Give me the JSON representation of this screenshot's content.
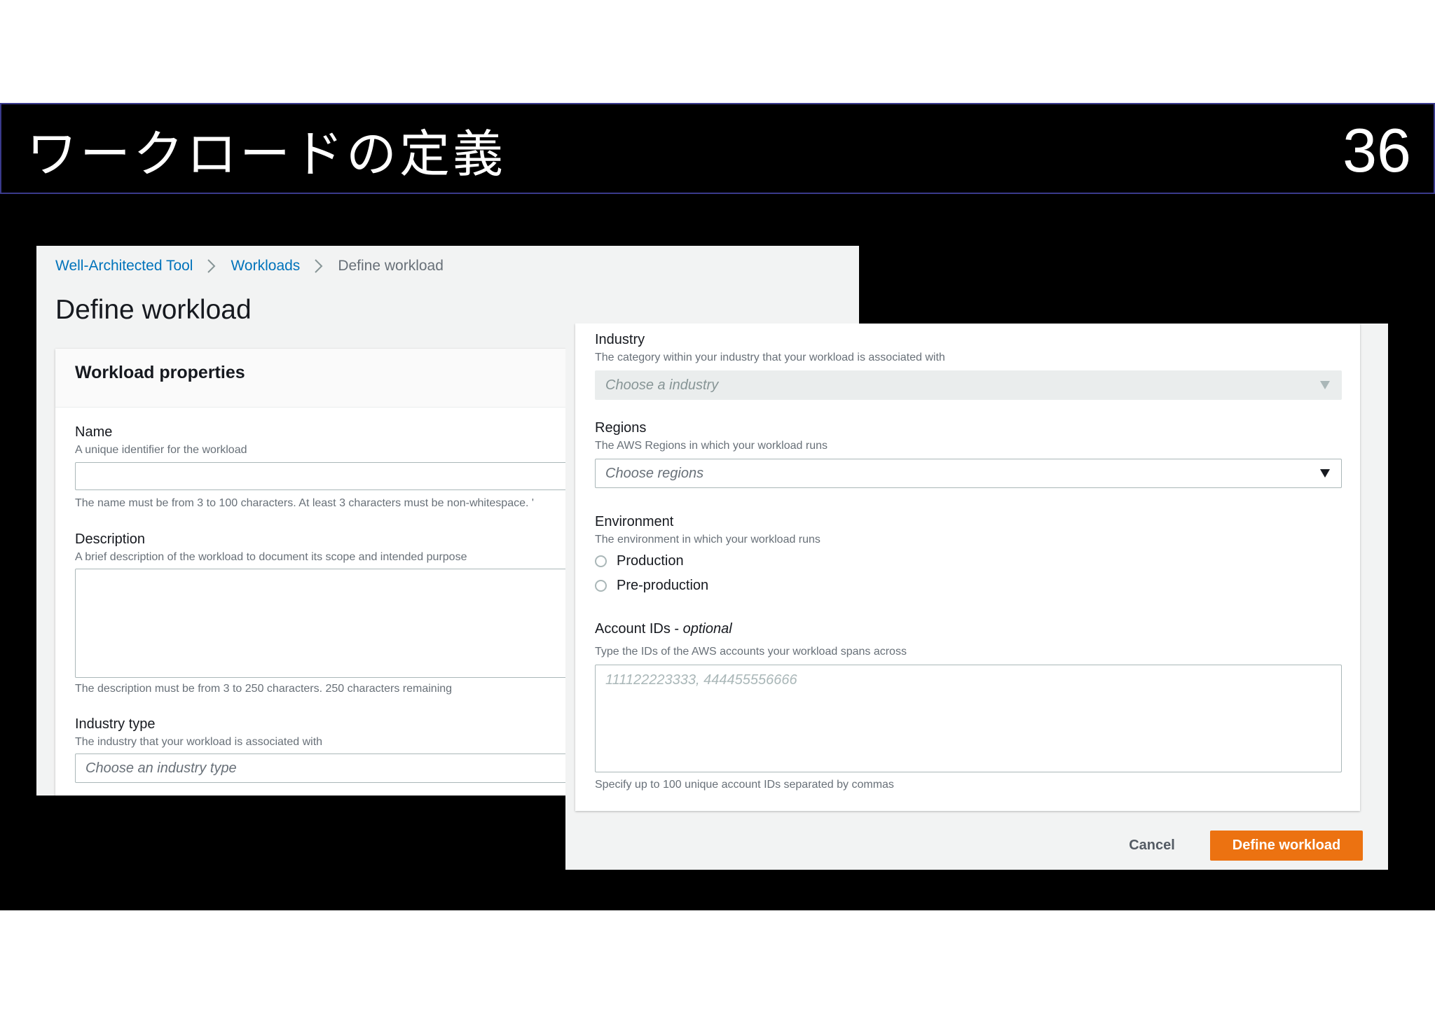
{
  "slide": {
    "title": "ワークロードの定義",
    "page_number": "36"
  },
  "left_panel": {
    "breadcrumb": [
      "Well-Architected Tool",
      "Workloads",
      "Define workload"
    ],
    "page_title": "Define workload",
    "card_title": "Workload properties",
    "name": {
      "label": "Name",
      "description": "A unique identifier for the workload",
      "value": "",
      "hint": "The name must be from 3 to 100 characters. At least 3 characters must be non-whitespace. '"
    },
    "description": {
      "label": "Description",
      "description": "A brief description of the workload to document its scope and intended purpose",
      "value": "",
      "hint": "The description must be from 3 to 250 characters. 250 characters remaining"
    },
    "industry_type": {
      "label": "Industry type",
      "description": "The industry that your workload is associated with",
      "placeholder": "Choose an industry type"
    }
  },
  "right_panel": {
    "industry": {
      "label": "Industry",
      "description": "The category within your industry that your workload is associated with",
      "placeholder": "Choose a industry",
      "disabled": true
    },
    "regions": {
      "label": "Regions",
      "description": "The AWS Regions in which your workload runs",
      "placeholder": "Choose regions"
    },
    "environment": {
      "label": "Environment",
      "description": "The environment in which your workload runs",
      "options": [
        "Production",
        "Pre-production"
      ],
      "selected": null
    },
    "account_ids": {
      "label": "Account IDs - ",
      "label_optional": "optional",
      "description": "Type the IDs of the AWS accounts your workload spans across",
      "placeholder": "111122223333, 444455556666",
      "hint": "Specify up to 100 unique account IDs separated by commas"
    },
    "actions": {
      "cancel": "Cancel",
      "submit": "Define workload"
    }
  },
  "colors": {
    "link": "#0073bb",
    "primary_button": "#ec7211",
    "slide_background": "#000000"
  }
}
